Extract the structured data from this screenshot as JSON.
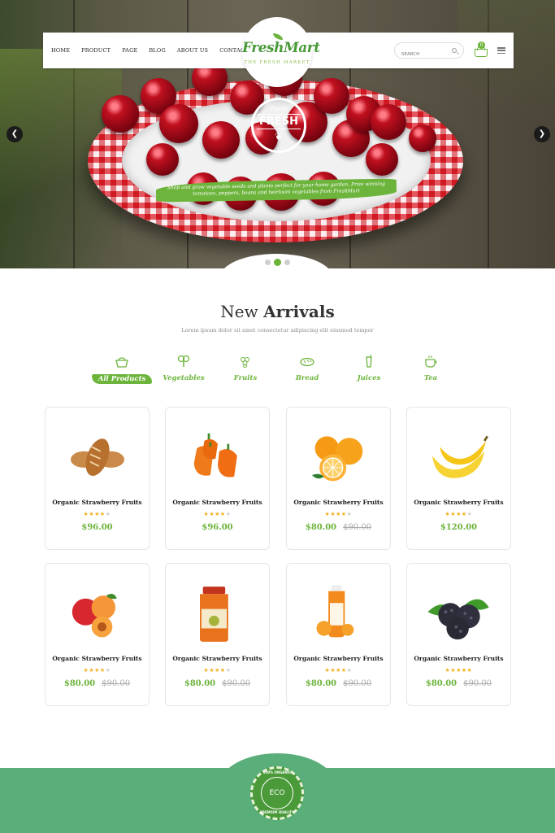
{
  "nav": {
    "links": [
      "HOME",
      "PRODUCT",
      "PAGE",
      "BLOG",
      "ABOUT US",
      "CONTACT"
    ],
    "search_placeholder": "SEARCH",
    "cart_count": "0"
  },
  "logo": {
    "name": "FreshMart",
    "tagline": "THE FRESH MARKET"
  },
  "hero": {
    "badge_small": "Farm",
    "badge_big": "FRESH",
    "caption": "Shop and grow vegetable seeds and plants perfect for your home garden. Prize winning tomatoes, peppers, beans and heirloom vegetables from FreshMart",
    "prev_icon": "chevron-left-icon",
    "next_icon": "chevron-right-icon",
    "slides": 3,
    "active_slide": 2
  },
  "arrivals": {
    "title_light": "New ",
    "title_bold": "Arrivals",
    "subtitle": "Lorem ipsum dolor sit amet consectetur adipiscing elit eiusmod tempor",
    "categories": [
      {
        "label": "All Products",
        "icon": "basket-icon",
        "active": true
      },
      {
        "label": "Vegetables",
        "icon": "broccoli-icon",
        "active": false
      },
      {
        "label": "Fruits",
        "icon": "grapes-icon",
        "active": false
      },
      {
        "label": "Bread",
        "icon": "bread-icon",
        "active": false
      },
      {
        "label": "Juices",
        "icon": "juice-icon",
        "active": false
      },
      {
        "label": "Tea",
        "icon": "tea-icon",
        "active": false
      }
    ],
    "products": [
      {
        "name": "Organic Strawberry Fruits",
        "rating": 4,
        "price": "$96.00",
        "old_price": "",
        "image": "bread-image"
      },
      {
        "name": "Organic Strawberry Fruits",
        "rating": 4,
        "price": "$96.00",
        "old_price": "",
        "image": "peppers-image"
      },
      {
        "name": "Organic Strawberry Fruits",
        "rating": 4,
        "price": "$80.00",
        "old_price": "$90.00",
        "image": "oranges-image"
      },
      {
        "name": "Organic Strawberry Fruits",
        "rating": 4,
        "price": "$120.00",
        "old_price": "",
        "image": "bananas-image"
      },
      {
        "name": "Organic Strawberry Fruits",
        "rating": 4,
        "price": "$80.00",
        "old_price": "$90.00",
        "image": "apricots-image"
      },
      {
        "name": "Organic Strawberry Fruits",
        "rating": 4,
        "price": "$80.00",
        "old_price": "$90.00",
        "image": "juice-jar-image"
      },
      {
        "name": "Organic Strawberry Fruits",
        "rating": 4,
        "price": "$80.00",
        "old_price": "$90.00",
        "image": "juice-bottle-image"
      },
      {
        "name": "Organic Strawberry Fruits",
        "rating": 5,
        "price": "$80.00",
        "old_price": "$90.00",
        "image": "blackberries-image"
      }
    ]
  },
  "seal": {
    "top": "100% ORGANIC",
    "center": "ECO",
    "bottom": "PREMIUM QUALITY"
  },
  "colors": {
    "accent": "#6cb43b",
    "footer": "#5aae7a",
    "star": "#f2b01e"
  }
}
